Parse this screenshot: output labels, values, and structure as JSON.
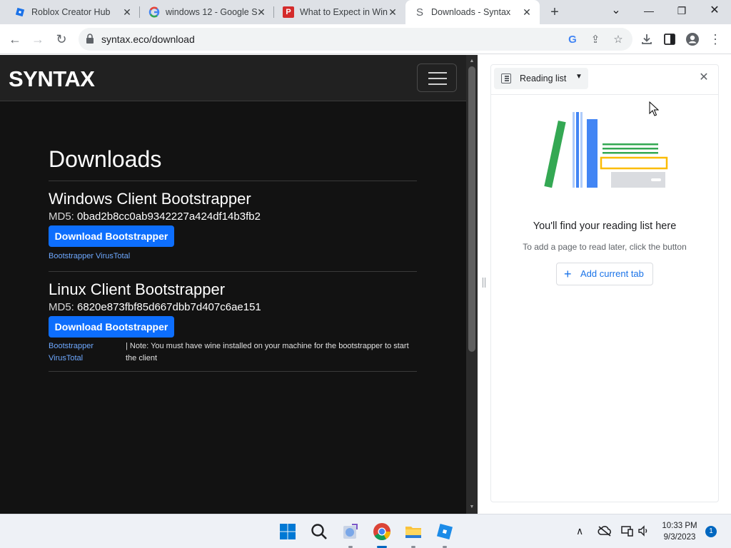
{
  "browser": {
    "tabs": [
      {
        "title": "Roblox Creator Hub",
        "icon": "roblox-icon"
      },
      {
        "title": "windows 12 - Google S",
        "icon": "google-icon"
      },
      {
        "title": "What to Expect in Win",
        "icon": "pcmag-icon"
      },
      {
        "title": "Downloads - Syntax",
        "icon": "syntax-icon",
        "active": true
      }
    ],
    "new_tab": "+",
    "window_controls": {
      "chevron": "⌄",
      "minimize": "—",
      "restore": "❐",
      "close": "✕"
    },
    "url": "syntax.eco/download"
  },
  "page": {
    "brand": "SYNTAX",
    "heading": "Downloads",
    "sections": [
      {
        "title": "Windows Client Bootstrapper",
        "md5_label": "MD5:",
        "md5": "0bad2b8cc0ab9342227a424df14b3fb2",
        "button": "Download Bootstrapper",
        "link": "Bootstrapper VirusTotal"
      },
      {
        "title": "Linux Client Bootstrapper",
        "md5_label": "MD5:",
        "md5": "6820e873fbf85d667dbb7d407c6ae151",
        "button": "Download Bootstrapper",
        "link": "Bootstrapper VirusTotal",
        "note": "| Note: You must have wine installed on your machine for the bootstrapper to start the client"
      }
    ]
  },
  "side_panel": {
    "title": "Reading list",
    "empty_title": "You'll find your reading list here",
    "empty_subtitle": "To add a page to read later, click the button",
    "add_button": "Add current tab"
  },
  "taskbar": {
    "time": "10:33 PM",
    "date": "9/3/2023",
    "notifications": "1"
  },
  "colors": {
    "accent_button": "#0d6efd",
    "link": "#6ea8fe",
    "page_bg": "#121212",
    "panel_link": "#1a73e8"
  }
}
